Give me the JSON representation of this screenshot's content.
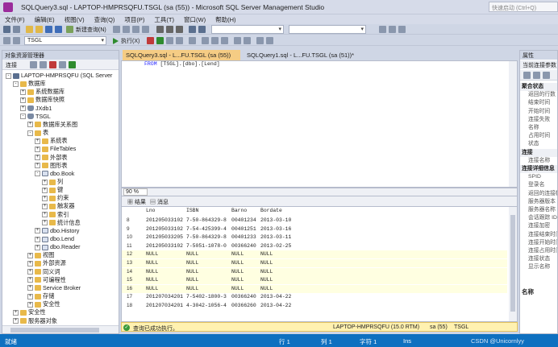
{
  "window": {
    "title": "SQLQuery3.sql - LAPTOP-HMPRSQFU.TSGL (sa (55)) - Microsoft SQL Server Management Studio",
    "quick_launch": "快速启动 (Ctrl+Q)"
  },
  "menu": [
    "文件(F)",
    "编辑(E)",
    "视图(V)",
    "查询(Q)",
    "项目(P)",
    "工具(T)",
    "窗口(W)",
    "帮助(H)"
  ],
  "toolbar": {
    "new_query": "新建查询(N)",
    "database": "TSGL",
    "execute": "执行(X)"
  },
  "object_explorer": {
    "title": "对象资源管理器",
    "connect": "连接",
    "nodes": [
      {
        "label": "LAPTOP-HMPRSQFU (SQL Server",
        "indent": 0,
        "exp": "-",
        "icon": "srv"
      },
      {
        "label": "数据库",
        "indent": 1,
        "exp": "-",
        "icon": "folder"
      },
      {
        "label": "系统数据库",
        "indent": 2,
        "exp": "+",
        "icon": "folder"
      },
      {
        "label": "数据库快照",
        "indent": 2,
        "exp": "+",
        "icon": "folder"
      },
      {
        "label": "JXdb1",
        "indent": 2,
        "exp": "+",
        "icon": "db"
      },
      {
        "label": "TSGL",
        "indent": 2,
        "exp": "-",
        "icon": "db"
      },
      {
        "label": "数据库关系图",
        "indent": 3,
        "exp": "+",
        "icon": "folder"
      },
      {
        "label": "表",
        "indent": 3,
        "exp": "-",
        "icon": "folder"
      },
      {
        "label": "系统表",
        "indent": 4,
        "exp": "+",
        "icon": "folder"
      },
      {
        "label": "FileTables",
        "indent": 4,
        "exp": "+",
        "icon": "folder"
      },
      {
        "label": "外部表",
        "indent": 4,
        "exp": "+",
        "icon": "folder"
      },
      {
        "label": "图形表",
        "indent": 4,
        "exp": "+",
        "icon": "folder"
      },
      {
        "label": "dbo.Book",
        "indent": 4,
        "exp": "-",
        "icon": "tbl"
      },
      {
        "label": "列",
        "indent": 5,
        "exp": "+",
        "icon": "folder"
      },
      {
        "label": "键",
        "indent": 5,
        "exp": "+",
        "icon": "folder"
      },
      {
        "label": "约束",
        "indent": 5,
        "exp": "+",
        "icon": "folder"
      },
      {
        "label": "触发器",
        "indent": 5,
        "exp": "+",
        "icon": "folder"
      },
      {
        "label": "索引",
        "indent": 5,
        "exp": "+",
        "icon": "folder"
      },
      {
        "label": "统计信息",
        "indent": 5,
        "exp": "+",
        "icon": "folder"
      },
      {
        "label": "dbo.History",
        "indent": 4,
        "exp": "+",
        "icon": "tbl"
      },
      {
        "label": "dbo.Lend",
        "indent": 4,
        "exp": "+",
        "icon": "tbl"
      },
      {
        "label": "dbo.Reader",
        "indent": 4,
        "exp": "+",
        "icon": "tbl"
      },
      {
        "label": "视图",
        "indent": 3,
        "exp": "+",
        "icon": "folder"
      },
      {
        "label": "外部资源",
        "indent": 3,
        "exp": "+",
        "icon": "folder"
      },
      {
        "label": "同义词",
        "indent": 3,
        "exp": "+",
        "icon": "folder"
      },
      {
        "label": "可编程性",
        "indent": 3,
        "exp": "+",
        "icon": "folder"
      },
      {
        "label": "Service Broker",
        "indent": 3,
        "exp": "+",
        "icon": "folder"
      },
      {
        "label": "存储",
        "indent": 3,
        "exp": "+",
        "icon": "folder"
      },
      {
        "label": "安全性",
        "indent": 3,
        "exp": "+",
        "icon": "folder"
      },
      {
        "label": "安全性",
        "indent": 1,
        "exp": "+",
        "icon": "folder"
      },
      {
        "label": "服务器对象",
        "indent": 1,
        "exp": "+",
        "icon": "folder"
      }
    ]
  },
  "tabs": {
    "active": "SQLQuery3.sql - L...FU.TSGL (sa (55))",
    "inactive": "SQLQuery1.sql - L...FU.TSGL (sa (51))*"
  },
  "editor": {
    "code_kw": "FROM",
    "code_rest": "[TSGL].[dbo].[Lend]"
  },
  "zoom": "90 %",
  "results": {
    "tab_results": "结果",
    "tab_messages": "消息",
    "columns": [
      "Lno",
      "ISBN",
      "Barno",
      "Bordate"
    ],
    "rows": [
      {
        "n": "8",
        "c": [
          "201205033102",
          "7-50-864329-8",
          "00401234",
          "2013-03-10"
        ]
      },
      {
        "n": "9",
        "c": [
          "201205033102",
          "7-54-425399-4",
          "00401251",
          "2013-03-16"
        ]
      },
      {
        "n": "10",
        "c": [
          "201205033205",
          "7-50-864329-8",
          "00401233",
          "2013-03-11"
        ]
      },
      {
        "n": "11",
        "c": [
          "201205033102",
          "7-5051-1078-0",
          "00366240",
          "2013-02-25"
        ]
      },
      {
        "n": "12",
        "c": [
          "NULL",
          "NULL",
          "NULL",
          "NULL"
        ],
        "null": true
      },
      {
        "n": "13",
        "c": [
          "NULL",
          "NULL",
          "NULL",
          "NULL"
        ],
        "null": true
      },
      {
        "n": "14",
        "c": [
          "NULL",
          "NULL",
          "NULL",
          "NULL"
        ],
        "null": true
      },
      {
        "n": "15",
        "c": [
          "NULL",
          "NULL",
          "NULL",
          "NULL"
        ],
        "null": true
      },
      {
        "n": "16",
        "c": [
          "NULL",
          "NULL",
          "NULL",
          "NULL"
        ],
        "null": true
      },
      {
        "n": "17",
        "c": [
          "201207034201",
          "7-5402-1800-3",
          "00366240",
          "2013-04-22"
        ]
      },
      {
        "n": "18",
        "c": [
          "201207034201",
          "4-3042-1056-4",
          "00366260",
          "2013-04-22"
        ]
      }
    ]
  },
  "query_status": {
    "message": "查询已成功执行。",
    "server": "LAPTOP-HMPRSQFU (15.0 RTM)",
    "user": "sa (55)",
    "db": "TSGL"
  },
  "properties": {
    "title": "属性",
    "current": "当前连接参数",
    "items": [
      {
        "t": "聚合状态",
        "cat": true
      },
      {
        "t": "返回的行数"
      },
      {
        "t": "结束时间"
      },
      {
        "t": "开始时间"
      },
      {
        "t": "连接失败"
      },
      {
        "t": "名称"
      },
      {
        "t": "占用时间"
      },
      {
        "t": "状态"
      },
      {
        "t": "连接",
        "cat": true
      },
      {
        "t": "连接名称"
      },
      {
        "t": "连接详细信息",
        "cat": true
      },
      {
        "t": "SPID"
      },
      {
        "t": "登录名"
      },
      {
        "t": "返回的连接帐"
      },
      {
        "t": "服务器版本"
      },
      {
        "t": "服务器名称"
      },
      {
        "t": "会话跟踪 ID"
      },
      {
        "t": "连接加密"
      },
      {
        "t": "连接结束时间"
      },
      {
        "t": "连接开始时间"
      },
      {
        "t": "连接占用时间"
      },
      {
        "t": "连接状态"
      },
      {
        "t": "显示名称"
      }
    ],
    "footer": "名称"
  },
  "statusbar": {
    "ready": "就绪",
    "row": "行 1",
    "col": "列 1",
    "char": "字符 1",
    "ins": "Ins",
    "watermark": "CSDN @Unicornlyy"
  }
}
